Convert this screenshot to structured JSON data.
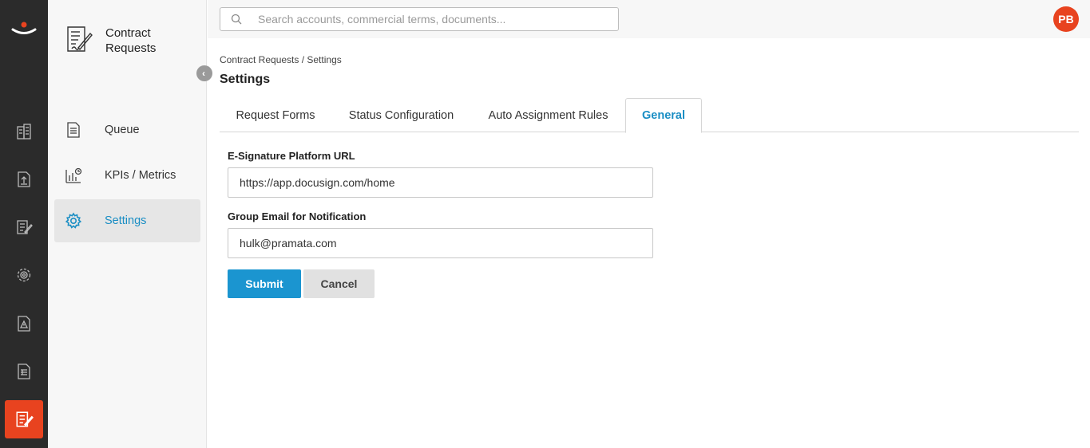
{
  "app": {
    "title": "Contract Requests",
    "accent": "#1a8ec4",
    "brand": "#e8431f"
  },
  "rail": {
    "icons": [
      "logo-icon",
      "buildings-icon",
      "document-upload-icon",
      "document-edit-icon",
      "gear-network-icon",
      "warning-document-icon",
      "document-list-icon",
      "contract-requests-icon"
    ]
  },
  "sidebar": {
    "collapse_icon": "chevron-left-icon",
    "items": [
      {
        "label": "Queue",
        "icon": "document-icon"
      },
      {
        "label": "KPIs / Metrics",
        "icon": "chart-icon"
      },
      {
        "label": "Settings",
        "icon": "gear-icon",
        "active": true
      }
    ]
  },
  "topbar": {
    "search_placeholder": "Search accounts, commercial terms, documents...",
    "avatar_initials": "PB"
  },
  "main": {
    "breadcrumb": "Contract Requests / Settings",
    "page_title": "Settings",
    "tabs": [
      {
        "label": "Request Forms"
      },
      {
        "label": "Status Configuration"
      },
      {
        "label": "Auto Assignment Rules"
      },
      {
        "label": "General",
        "active": true
      }
    ],
    "form": {
      "esig_label": "E-Signature Platform URL",
      "esig_value": "https://app.docusign.com/home",
      "email_label": "Group Email for Notification",
      "email_value": "hulk@pramata.com",
      "submit_label": "Submit",
      "cancel_label": "Cancel"
    }
  }
}
